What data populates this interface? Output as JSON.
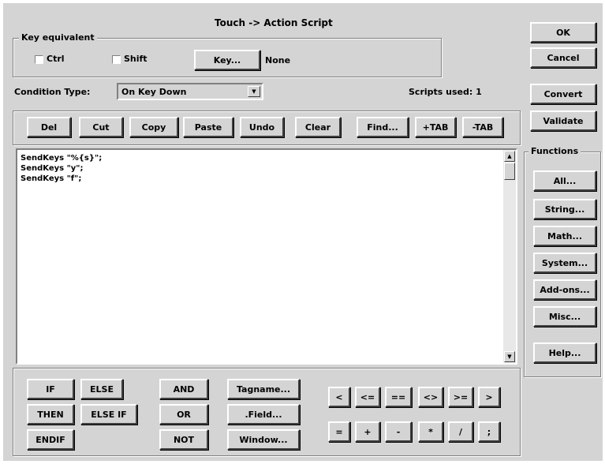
{
  "window": {
    "title": "Touch -> Action Script"
  },
  "key_equivalent": {
    "legend": "Key equivalent",
    "ctrl_label": "Ctrl",
    "shift_label": "Shift",
    "key_button": "Key...",
    "key_value": "None"
  },
  "condition": {
    "label": "Condition Type:",
    "value": "On Key Down",
    "scripts_used": "Scripts used: 1"
  },
  "right_buttons": {
    "ok": "OK",
    "cancel": "Cancel",
    "convert": "Convert",
    "validate": "Validate"
  },
  "toolbar": [
    "Del",
    "Cut",
    "Copy",
    "Paste",
    "Undo",
    "Clear",
    "Find...",
    "+TAB",
    "-TAB"
  ],
  "script_text": "SendKeys \"%{s}\";\nSendKeys \"y\";\nSendKeys \"f\";",
  "functions": {
    "legend": "Functions",
    "buttons": [
      "All...",
      "String...",
      "Math...",
      "System...",
      "Add-ons...",
      "Misc...",
      "Help..."
    ]
  },
  "logic": {
    "if": "IF",
    "else": "ELSE",
    "then": "THEN",
    "else_if": "ELSE IF",
    "endif": "ENDIF",
    "and": "AND",
    "or": "OR",
    "not": "NOT",
    "tagname": "Tagname...",
    "field": ".Field...",
    "window": "Window..."
  },
  "operators": {
    "row1": [
      "<",
      "<=",
      "==",
      "<>",
      ">=",
      ">"
    ],
    "row2": [
      "=",
      "+",
      "-",
      "*",
      "/",
      ";"
    ]
  }
}
